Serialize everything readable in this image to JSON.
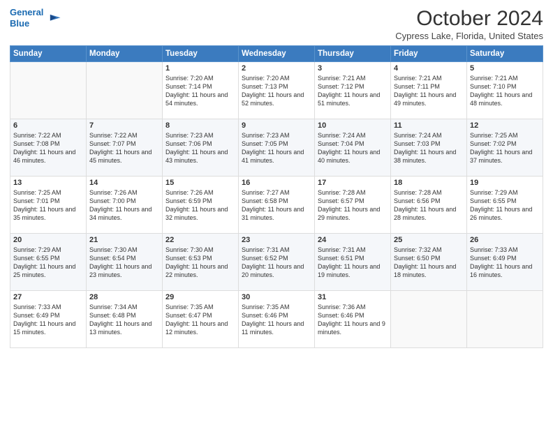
{
  "header": {
    "logo_line1": "General",
    "logo_line2": "Blue",
    "month_title": "October 2024",
    "location": "Cypress Lake, Florida, United States"
  },
  "weekdays": [
    "Sunday",
    "Monday",
    "Tuesday",
    "Wednesday",
    "Thursday",
    "Friday",
    "Saturday"
  ],
  "rows": [
    [
      {
        "day": "",
        "sunrise": "",
        "sunset": "",
        "daylight": ""
      },
      {
        "day": "",
        "sunrise": "",
        "sunset": "",
        "daylight": ""
      },
      {
        "day": "1",
        "sunrise": "Sunrise: 7:20 AM",
        "sunset": "Sunset: 7:14 PM",
        "daylight": "Daylight: 11 hours and 54 minutes."
      },
      {
        "day": "2",
        "sunrise": "Sunrise: 7:20 AM",
        "sunset": "Sunset: 7:13 PM",
        "daylight": "Daylight: 11 hours and 52 minutes."
      },
      {
        "day": "3",
        "sunrise": "Sunrise: 7:21 AM",
        "sunset": "Sunset: 7:12 PM",
        "daylight": "Daylight: 11 hours and 51 minutes."
      },
      {
        "day": "4",
        "sunrise": "Sunrise: 7:21 AM",
        "sunset": "Sunset: 7:11 PM",
        "daylight": "Daylight: 11 hours and 49 minutes."
      },
      {
        "day": "5",
        "sunrise": "Sunrise: 7:21 AM",
        "sunset": "Sunset: 7:10 PM",
        "daylight": "Daylight: 11 hours and 48 minutes."
      }
    ],
    [
      {
        "day": "6",
        "sunrise": "Sunrise: 7:22 AM",
        "sunset": "Sunset: 7:08 PM",
        "daylight": "Daylight: 11 hours and 46 minutes."
      },
      {
        "day": "7",
        "sunrise": "Sunrise: 7:22 AM",
        "sunset": "Sunset: 7:07 PM",
        "daylight": "Daylight: 11 hours and 45 minutes."
      },
      {
        "day": "8",
        "sunrise": "Sunrise: 7:23 AM",
        "sunset": "Sunset: 7:06 PM",
        "daylight": "Daylight: 11 hours and 43 minutes."
      },
      {
        "day": "9",
        "sunrise": "Sunrise: 7:23 AM",
        "sunset": "Sunset: 7:05 PM",
        "daylight": "Daylight: 11 hours and 41 minutes."
      },
      {
        "day": "10",
        "sunrise": "Sunrise: 7:24 AM",
        "sunset": "Sunset: 7:04 PM",
        "daylight": "Daylight: 11 hours and 40 minutes."
      },
      {
        "day": "11",
        "sunrise": "Sunrise: 7:24 AM",
        "sunset": "Sunset: 7:03 PM",
        "daylight": "Daylight: 11 hours and 38 minutes."
      },
      {
        "day": "12",
        "sunrise": "Sunrise: 7:25 AM",
        "sunset": "Sunset: 7:02 PM",
        "daylight": "Daylight: 11 hours and 37 minutes."
      }
    ],
    [
      {
        "day": "13",
        "sunrise": "Sunrise: 7:25 AM",
        "sunset": "Sunset: 7:01 PM",
        "daylight": "Daylight: 11 hours and 35 minutes."
      },
      {
        "day": "14",
        "sunrise": "Sunrise: 7:26 AM",
        "sunset": "Sunset: 7:00 PM",
        "daylight": "Daylight: 11 hours and 34 minutes."
      },
      {
        "day": "15",
        "sunrise": "Sunrise: 7:26 AM",
        "sunset": "Sunset: 6:59 PM",
        "daylight": "Daylight: 11 hours and 32 minutes."
      },
      {
        "day": "16",
        "sunrise": "Sunrise: 7:27 AM",
        "sunset": "Sunset: 6:58 PM",
        "daylight": "Daylight: 11 hours and 31 minutes."
      },
      {
        "day": "17",
        "sunrise": "Sunrise: 7:28 AM",
        "sunset": "Sunset: 6:57 PM",
        "daylight": "Daylight: 11 hours and 29 minutes."
      },
      {
        "day": "18",
        "sunrise": "Sunrise: 7:28 AM",
        "sunset": "Sunset: 6:56 PM",
        "daylight": "Daylight: 11 hours and 28 minutes."
      },
      {
        "day": "19",
        "sunrise": "Sunrise: 7:29 AM",
        "sunset": "Sunset: 6:55 PM",
        "daylight": "Daylight: 11 hours and 26 minutes."
      }
    ],
    [
      {
        "day": "20",
        "sunrise": "Sunrise: 7:29 AM",
        "sunset": "Sunset: 6:55 PM",
        "daylight": "Daylight: 11 hours and 25 minutes."
      },
      {
        "day": "21",
        "sunrise": "Sunrise: 7:30 AM",
        "sunset": "Sunset: 6:54 PM",
        "daylight": "Daylight: 11 hours and 23 minutes."
      },
      {
        "day": "22",
        "sunrise": "Sunrise: 7:30 AM",
        "sunset": "Sunset: 6:53 PM",
        "daylight": "Daylight: 11 hours and 22 minutes."
      },
      {
        "day": "23",
        "sunrise": "Sunrise: 7:31 AM",
        "sunset": "Sunset: 6:52 PM",
        "daylight": "Daylight: 11 hours and 20 minutes."
      },
      {
        "day": "24",
        "sunrise": "Sunrise: 7:31 AM",
        "sunset": "Sunset: 6:51 PM",
        "daylight": "Daylight: 11 hours and 19 minutes."
      },
      {
        "day": "25",
        "sunrise": "Sunrise: 7:32 AM",
        "sunset": "Sunset: 6:50 PM",
        "daylight": "Daylight: 11 hours and 18 minutes."
      },
      {
        "day": "26",
        "sunrise": "Sunrise: 7:33 AM",
        "sunset": "Sunset: 6:49 PM",
        "daylight": "Daylight: 11 hours and 16 minutes."
      }
    ],
    [
      {
        "day": "27",
        "sunrise": "Sunrise: 7:33 AM",
        "sunset": "Sunset: 6:49 PM",
        "daylight": "Daylight: 11 hours and 15 minutes."
      },
      {
        "day": "28",
        "sunrise": "Sunrise: 7:34 AM",
        "sunset": "Sunset: 6:48 PM",
        "daylight": "Daylight: 11 hours and 13 minutes."
      },
      {
        "day": "29",
        "sunrise": "Sunrise: 7:35 AM",
        "sunset": "Sunset: 6:47 PM",
        "daylight": "Daylight: 11 hours and 12 minutes."
      },
      {
        "day": "30",
        "sunrise": "Sunrise: 7:35 AM",
        "sunset": "Sunset: 6:46 PM",
        "daylight": "Daylight: 11 hours and 11 minutes."
      },
      {
        "day": "31",
        "sunrise": "Sunrise: 7:36 AM",
        "sunset": "Sunset: 6:46 PM",
        "daylight": "Daylight: 11 hours and 9 minutes."
      },
      {
        "day": "",
        "sunrise": "",
        "sunset": "",
        "daylight": ""
      },
      {
        "day": "",
        "sunrise": "",
        "sunset": "",
        "daylight": ""
      }
    ]
  ]
}
